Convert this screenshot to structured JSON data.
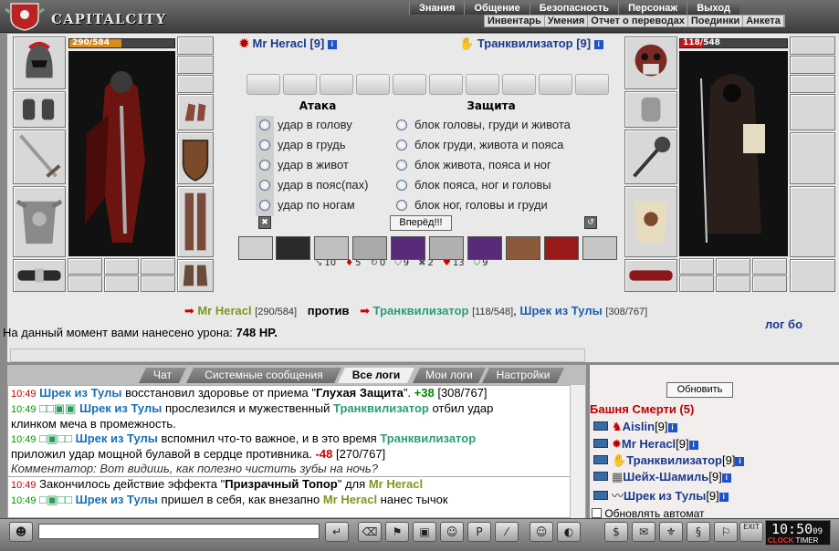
{
  "app": {
    "logo_text": "CAPITALCITY"
  },
  "nav_top": [
    "Знания",
    "Общение",
    "Безопасность",
    "Персонаж",
    "Выход"
  ],
  "nav_sub": [
    "Инвентарь",
    "Умения",
    "Отчет о переводах",
    "Поединки",
    "Анкета"
  ],
  "player": {
    "name": "Mr Heracl [9]",
    "hp_text": "290/584",
    "hp": 290,
    "hp_max": 584
  },
  "enemy": {
    "name": "Транквилизатор [9]",
    "hp_text": "118/548",
    "hp": 118,
    "hp_max": 548
  },
  "attack": {
    "header": "Атака",
    "options": [
      "удар в голову",
      "удар в грудь",
      "удар в живот",
      "удар в пояс(пах)",
      "удар по ногам"
    ]
  },
  "defense": {
    "header": "Защита",
    "options": [
      "блок головы, груди и живота",
      "блок груди, живота и пояса",
      "блок живота, пояса и ног",
      "блок пояса, ног и головы",
      "блок ног, головы и груди"
    ]
  },
  "go_button": "Вперёд!!!",
  "stats": [
    {
      "icon": "sword-icon",
      "glyph": "↘",
      "value": "10"
    },
    {
      "icon": "fire-icon",
      "glyph": "♦",
      "value": "5"
    },
    {
      "icon": "cycle-icon",
      "glyph": "↻",
      "value": "0"
    },
    {
      "icon": "shield-icon",
      "glyph": "⛉",
      "value": "9"
    },
    {
      "icon": "cross-icon",
      "glyph": "✖",
      "value": "2"
    },
    {
      "icon": "heart-icon",
      "glyph": "♥",
      "value": "13"
    },
    {
      "icon": "shield-small-icon",
      "glyph": "⛉",
      "value": "9"
    }
  ],
  "vs": {
    "left_name": "Mr Heracl",
    "left_hp": "[290/584]",
    "word": "против",
    "right_name1": "Транквилизатор",
    "right_hp1": "[118/548]",
    "sep": ",",
    "right_name2": "Шрек из Тулы",
    "right_hp2": "[308/767]"
  },
  "damage": {
    "label": "На данный момент вами нанесено урона:",
    "value": "748 HP."
  },
  "log_link": "лог бо",
  "tabs": [
    "Чат",
    "Системные сообщения",
    "Все логи",
    "Мои логи",
    "Настройки"
  ],
  "chat": {
    "l1": {
      "time": "10:49",
      "who": "Шрек из Тулы",
      "text1": " восстановил здоровье от приема \"",
      "eff": "Глухая Защита",
      "text2": "\". ",
      "num": "+38",
      "hp": " [308/767]"
    },
    "l2": {
      "time": "10:49",
      "marks": "□□▣▣",
      "who": "Шрек из Тулы",
      "text1": " прослезился и мужественный ",
      "who2": "Транквилизатор",
      "text2": " отбил удар"
    },
    "l3": {
      "text": "клинком меча в промежность."
    },
    "l4": {
      "time": "10:49",
      "marks": "□▣□□",
      "who": "Шрек из Тулы",
      "text1": " вспомнил что-то важное, и в это время ",
      "who2": "Транквилизатор"
    },
    "l5": {
      "text": "приложил удар мощной булавой в сердце противника. ",
      "num": "-48",
      "hp": " [270/767]"
    },
    "l6": {
      "text": "Комментатор: Вот видишь, как полезно чистить зубы на ночь?"
    },
    "l7": {
      "time": "10:49",
      "text1": " Закончилось действие эффекта \"",
      "eff": "Призрачный Топор",
      "text2": "\" для ",
      "who": "Mr Heracl"
    },
    "l8": {
      "time": "10:49",
      "marks": "□▣□□",
      "who": "Шрек из Тулы",
      "text1": " пришел в себя, как внезапно ",
      "who2": "Mr Heracl",
      "text2": " нанес тычок"
    }
  },
  "room": {
    "refresh": "Обновить",
    "title": "Башня Смерти (5)",
    "users": [
      {
        "name": "Aislin",
        "level": "[9]",
        "color": "#1b3a8c"
      },
      {
        "name": "Mr Heracl",
        "level": "[9]",
        "color": "#1b3a8c"
      },
      {
        "name": "Транквилизатор",
        "level": "[9]",
        "color": "#1b3a8c"
      },
      {
        "name": "Шейх-Шамиль",
        "level": "[9]",
        "color": "#1b3a8c"
      },
      {
        "name": "Шрек из Тулы",
        "level": "[9]",
        "color": "#1b3a8c"
      }
    ],
    "auto_label": "Обновлять автомат"
  },
  "clock": {
    "time": "10:50",
    "sec": "09",
    "label_red": "CLOCK",
    "label": "TIMER"
  },
  "exit_label": "EXIT",
  "colors": {
    "accent_blue": "#1b3a8c",
    "hp_player": "#d98b1e",
    "hp_enemy": "#c01818"
  }
}
